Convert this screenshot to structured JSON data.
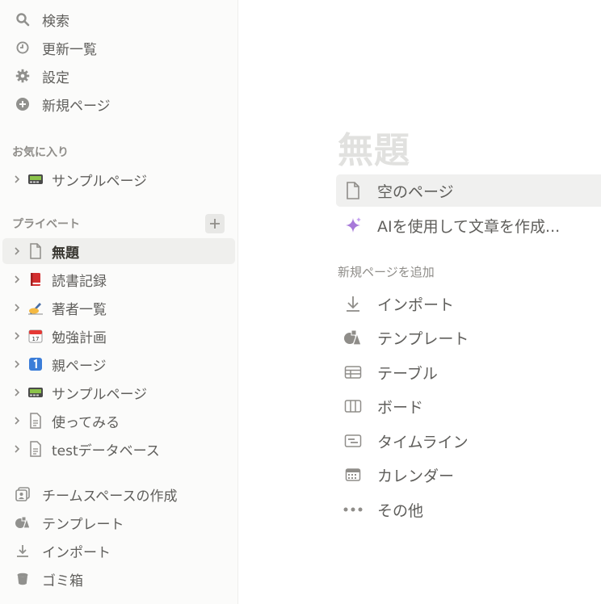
{
  "sidebar": {
    "top": [
      {
        "label": "検索",
        "icon": "search-icon"
      },
      {
        "label": "更新一覧",
        "icon": "clock-icon"
      },
      {
        "label": "設定",
        "icon": "gear-icon"
      },
      {
        "label": "新規ページ",
        "icon": "plus-circle-icon"
      }
    ],
    "favorites_label": "お気に入り",
    "favorites": [
      {
        "label": "サンプルページ",
        "icon": "pager-icon"
      }
    ],
    "private_label": "プライベート",
    "private": [
      {
        "label": "無題",
        "icon": "page-icon"
      },
      {
        "label": "読書記録",
        "icon": "red-book-icon"
      },
      {
        "label": "著者一覧",
        "icon": "writing-hand-icon"
      },
      {
        "label": "勉強計画",
        "icon": "calendar-icon"
      },
      {
        "label": "親ページ",
        "icon": "number-one-icon"
      },
      {
        "label": "サンプルページ",
        "icon": "pager-icon"
      },
      {
        "label": "使ってみる",
        "icon": "document-icon"
      },
      {
        "label": "testデータベース",
        "icon": "document-icon"
      }
    ],
    "bottom": [
      {
        "label": "チームスペースの作成",
        "icon": "teamspace-icon"
      },
      {
        "label": "テンプレート",
        "icon": "shapes-icon"
      },
      {
        "label": "インポート",
        "icon": "download-icon"
      },
      {
        "label": "ゴミ箱",
        "icon": "trash-icon"
      }
    ]
  },
  "main": {
    "title": "無題",
    "options": [
      {
        "label": "空のページ",
        "icon": "page-icon"
      },
      {
        "label": "AIを使用して文章を作成...",
        "icon": "sparkle-icon"
      }
    ],
    "add_label": "新規ページを追加",
    "add_options": [
      {
        "label": "インポート",
        "icon": "download-icon"
      },
      {
        "label": "テンプレート",
        "icon": "shapes-icon"
      },
      {
        "label": "テーブル",
        "icon": "table-icon"
      },
      {
        "label": "ボード",
        "icon": "board-icon"
      },
      {
        "label": "タイムライン",
        "icon": "timeline-icon"
      },
      {
        "label": "カレンダー",
        "icon": "calendar-icon"
      },
      {
        "label": "その他",
        "icon": "more-icon"
      }
    ]
  },
  "colors": {
    "sidebar_bg": "#fbfbfa",
    "active_bg": "#efefed",
    "title": "#e1e1df",
    "text": "#37352f",
    "muted": "#8f8d89"
  }
}
